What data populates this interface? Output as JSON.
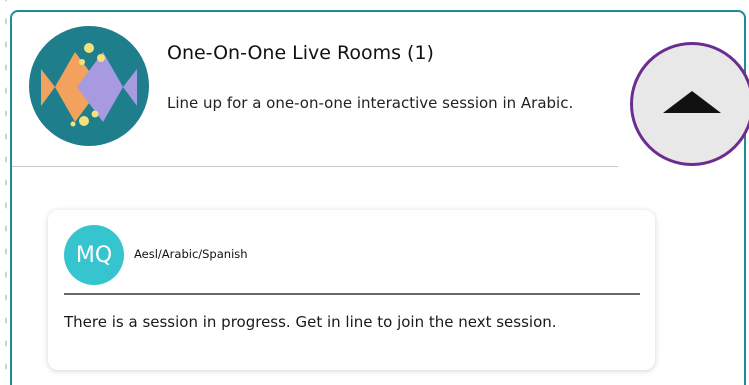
{
  "room": {
    "title": "One-On-One Live Rooms (1)",
    "description": "Line up for a one-on-one interactive session in Arabic.",
    "logo_icon": "fish-logo-icon",
    "collapse_icon": "triangle-up-icon"
  },
  "session_card": {
    "avatar_initials": "MQ",
    "tutor_languages": "Aesl/Arabic/Spanish",
    "status_text": "There is a session in progress. Get in line to join the next session."
  },
  "colors": {
    "panel_border": "#1f8a9a",
    "logo_bg": "#1e7e8c",
    "logo_fish_left": "#f2a25c",
    "logo_fish_right": "#a79ae0",
    "logo_dots": "#f3e27a",
    "collapse_ring": "#6b2d90",
    "avatar_bg": "#36c5cf"
  }
}
